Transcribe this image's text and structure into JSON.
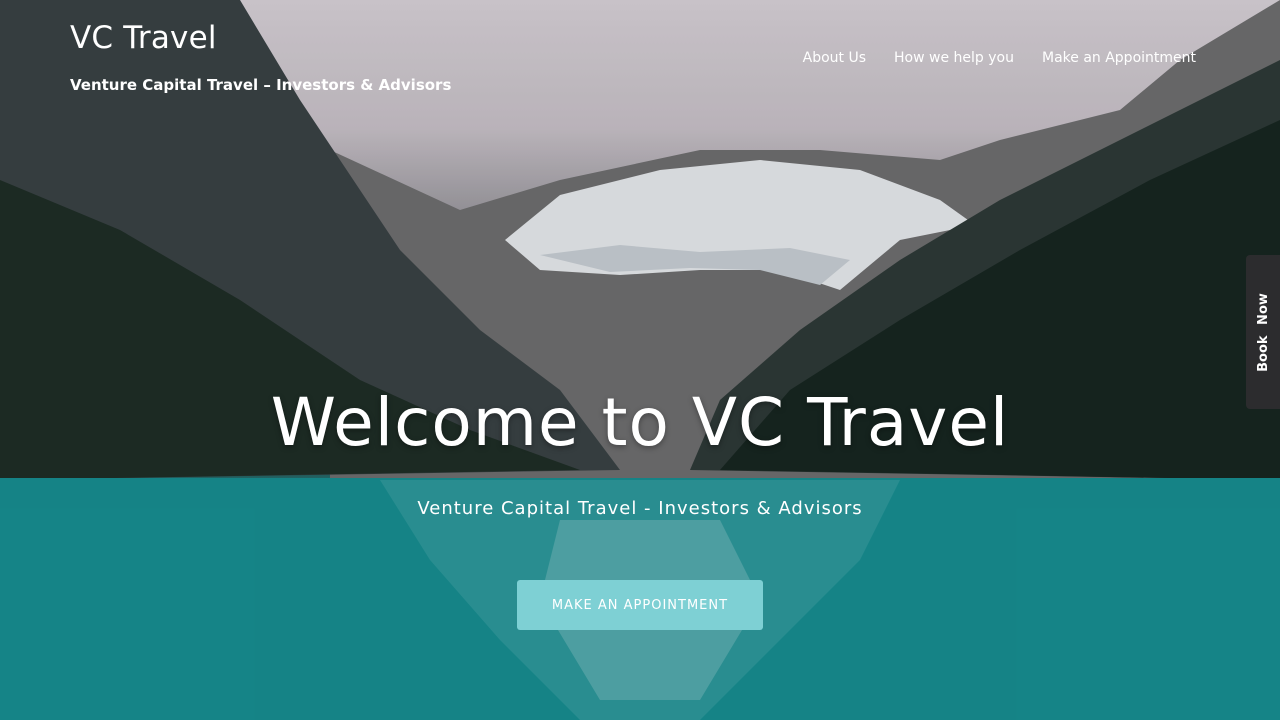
{
  "header": {
    "site_title": "VC Travel",
    "tagline": "Venture Capital Travel – Investors & Advisors"
  },
  "nav": {
    "items": [
      {
        "label": "About Us"
      },
      {
        "label": "How we help you"
      },
      {
        "label": "Make an Appointment"
      }
    ]
  },
  "hero": {
    "title": "Welcome to VC Travel",
    "subtitle": "Venture Capital Travel - Investors & Advisors",
    "cta_label": "MAKE AN APPOINTMENT",
    "background": "mountain-lake-photo"
  },
  "side_tab": {
    "label": "Book Now"
  },
  "colors": {
    "accent": "#7ed0d4",
    "tab_bg": "#2c2c2e",
    "text": "#ffffff",
    "water": "#178f92"
  }
}
